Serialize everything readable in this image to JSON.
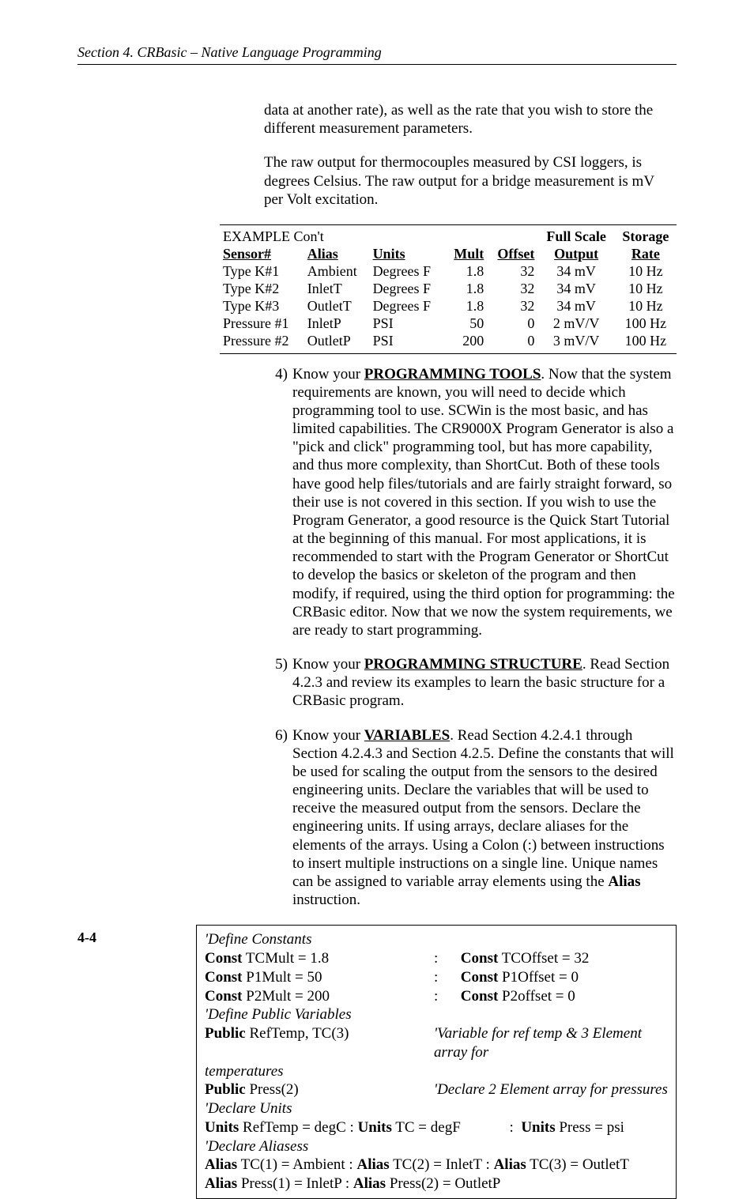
{
  "header": "Section 4.  CRBasic – Native Language Programming",
  "para1": "data at another rate), as well as the rate that you wish to store the different measurement parameters.",
  "para2": "The raw output for thermocouples measured by CSI loggers, is degrees Celsius.   The raw output for a bridge measurement is mV per Volt excitation.",
  "table": {
    "caption": "EXAMPLE Con't",
    "fullscale": "Full Scale",
    "storage": "Storage",
    "cols": [
      "Sensor#",
      "Alias",
      "Units",
      "Mult",
      "Offset",
      "Output",
      "Rate"
    ],
    "rows": [
      [
        "Type K#1",
        "Ambient",
        "Degrees F",
        "1.8",
        "32",
        "34 mV",
        "10 Hz"
      ],
      [
        "Type K#2",
        "InletT",
        "Degrees F",
        "1.8",
        "32",
        "34 mV",
        "10 Hz"
      ],
      [
        "Type K#3",
        "OutletT",
        "Degrees F",
        "1.8",
        "32",
        "34 mV",
        "10 Hz"
      ],
      [
        "Pressure #1",
        "InletP",
        "PSI",
        "50",
        "0",
        "2 mV/V",
        "100 Hz"
      ],
      [
        "Pressure #2",
        "OutletP",
        "PSI",
        "200",
        "0",
        "3 mV/V",
        "100 Hz"
      ]
    ]
  },
  "items": {
    "n4": "4)",
    "t4a": "Know your ",
    "t4b": "PROGRAMMING TOOLS",
    "t4c": ".  Now that the system requirements are known, you will need to decide which programming tool to use.  SCWin is the most basic, and has limited capabilities.  The CR9000X Program Generator is also a \"pick and click\" programming tool, but has more capability, and thus more complexity, than ShortCut.  Both of these tools have good help files/tutorials and are fairly straight forward, so their use is not covered in this section.  If you wish to use the Program Generator, a good resource is the Quick Start Tutorial at the beginning of this manual. For most applications, it is recommended to start with the Program Generator or ShortCut to develop the basics or skeleton of the program and then modify, if required, using the third option for programming: the CRBasic editor. Now that we now the system requirements, we are ready to start programming.",
    "n5": "5)",
    "t5a": "Know your ",
    "t5b": "PROGRAMMING STRUCTURE",
    "t5c": ".  Read Section 4.2.3 and review its examples to learn the basic structure for a CRBasic program.",
    "n6": "6)",
    "t6a": "Know your ",
    "t6b": "VARIABLES",
    "t6c": ". Read Section 4.2.4.1 through Section 4.2.4.3 and Section 4.2.5.  Define the constants that will be used for scaling the output from the sensors to the desired engineering units. Declare the variables that will be used to receive the measured output from the sensors. Declare the engineering units. If using arrays, declare aliases for the elements of the arrays. Using a Colon (:) between instructions to insert multiple instructions on a single line.  Unique names can be assigned to variable array elements using the ",
    "t6d": "Alias",
    "t6e": " instruction."
  },
  "code": {
    "l1": "'Define Constants",
    "k_const": "Const",
    "c1a": " TCMult = 1.8",
    "c1b": " TCOffset = 32",
    "c2a": " P1Mult = 50",
    "c2b": " P1Offset = 0",
    "c3a": " P2Mult = 200",
    "c3b": " P2offset = 0",
    "l5": "'Define Public Variables",
    "k_public": "Public",
    "p1": " RefTemp, TC(3)",
    "p1c": "'Variable for ref temp & 3 Element array for",
    "p1c2": "temperatures",
    "p2": " Press(2)",
    "p2c": "'Declare 2 Element array for pressures",
    "l8": "'Declare Units",
    "k_units": "Units",
    "u1": " RefTemp = degC   :  ",
    "u2": " TC = degF",
    "u3": " Press = psi",
    "l10": "'Declare Aliasess",
    "k_alias": "Alias",
    "a1": " TC(1) = Ambient   :   ",
    "a2": " TC(2) = InletT   :   ",
    "a3": " TC(3) = OutletT",
    "a4": " Press(1) = InletP    :   ",
    "a5": " Press(2) = OutletP",
    "colon": ":",
    "ucolon": "             :  "
  },
  "pagenum": "4-4"
}
